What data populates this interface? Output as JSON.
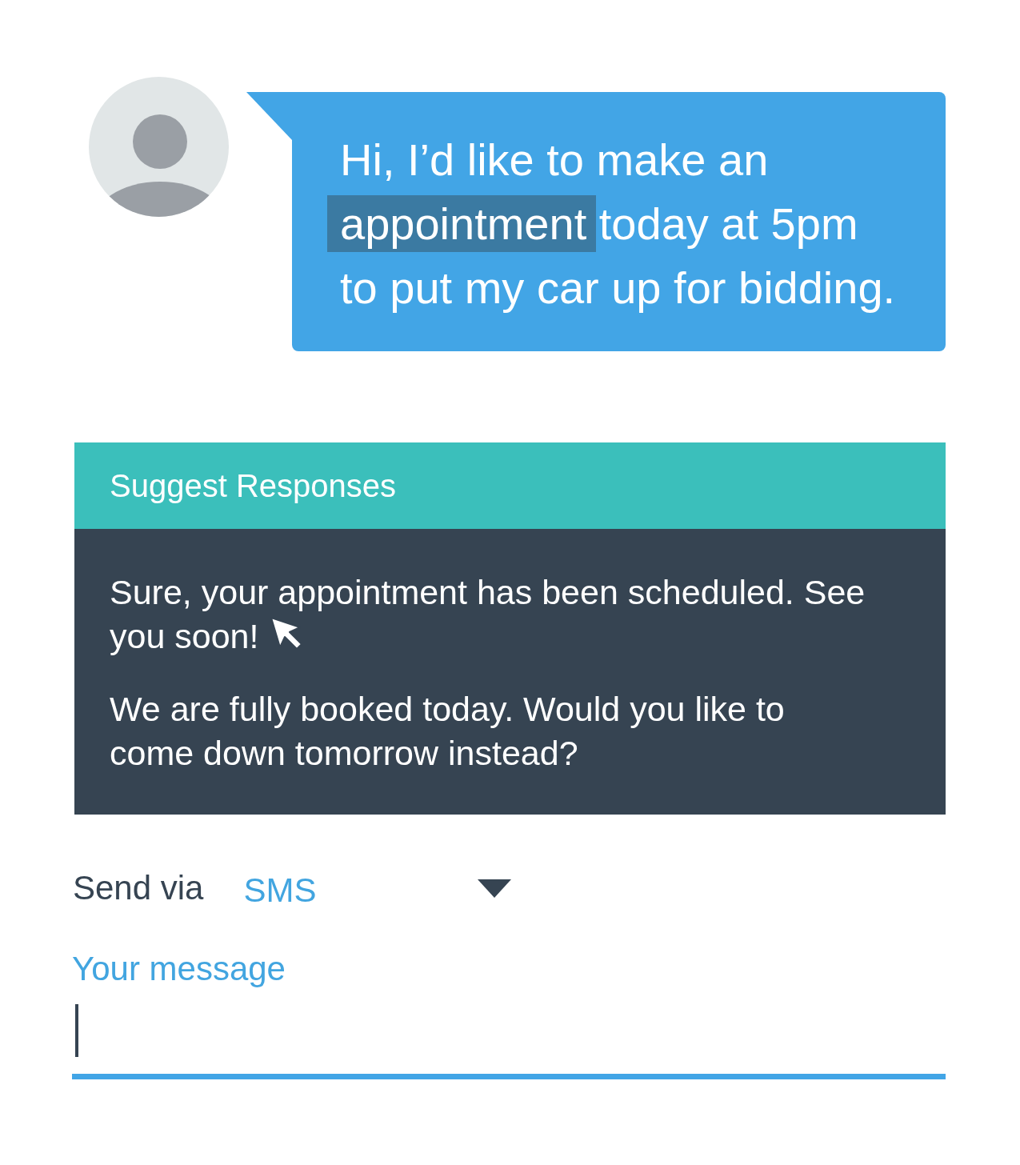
{
  "message": {
    "lines": [
      [
        {
          "text": "Hi, I’d like to make an",
          "highlighted": false
        }
      ],
      [
        {
          "text": "appointment",
          "highlighted": true
        },
        {
          "text": " today at 5pm",
          "highlighted": false
        }
      ],
      [
        {
          "text": "to put my car up for bidding.",
          "highlighted": false
        }
      ]
    ]
  },
  "suggestions": {
    "title": "Suggest Responses",
    "responses": [
      {
        "lines": [
          "Sure, your appointment has been scheduled. See",
          "you soon!"
        ],
        "hovered": true
      },
      {
        "lines": [
          "We are fully booked today. Would you like to",
          "come down tomorrow instead?"
        ],
        "hovered": false
      }
    ]
  },
  "send_via": {
    "label": "Send via",
    "value": "SMS"
  },
  "message_field": {
    "label": "Your message",
    "focused": true
  }
}
